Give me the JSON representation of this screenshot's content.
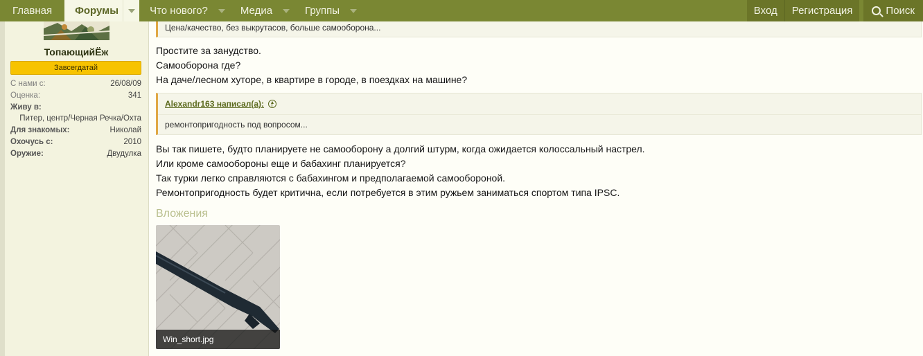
{
  "nav": {
    "home": "Главная",
    "forums": "Форумы",
    "whats_new": "Что нового?",
    "media": "Медиа",
    "groups": "Группы",
    "login": "Вход",
    "register": "Регистрация",
    "search": "Поиск"
  },
  "user": {
    "name": "ТопающийЁж",
    "badge": "Завсегдатай",
    "joined_label": "С нами с:",
    "joined": "26/08/09",
    "rating_label": "Оценка:",
    "rating": "341",
    "lives_label": "Живу в:",
    "lives": "Питер, центр/Черная Речка/Охта",
    "dating_label": "Для знакомых:",
    "dating": "Николай",
    "hunter_label": "Охочусь с:",
    "hunter": "2010",
    "weapon_label": "Оружие:",
    "weapon": "Двудулка"
  },
  "post": {
    "quote1_text": "Цена/качество, без выкрутасов, больше самооборона...",
    "para1": [
      "Простите за занудство.",
      "Самооборона где?",
      "На даче/лесном хуторе, в квартире в городе, в поездках на машине?"
    ],
    "quote2_author": "Alexandr163 написал(а):",
    "quote2_text": "ремонтопригодность под вопросом...",
    "para2": [
      "Вы так пишете, будто планируете не самооборону а долгий штурм, когда ожидается колоссальный настрел.",
      "Или кроме самообороны еще и бабахинг планируется?",
      "Так турки легко справляются с бабахингом и предполагаемой самообороной.",
      "Ремонтопригодность будет критична, если потребуется в этим ружьем заниматься спортом типа IPSC."
    ],
    "attachments_title": "Вложения",
    "attachment_name": "Win_short.jpg"
  },
  "colors": {
    "nav_bg": "#7a8733",
    "accent": "#e0a844",
    "badge": "#f7c300"
  }
}
